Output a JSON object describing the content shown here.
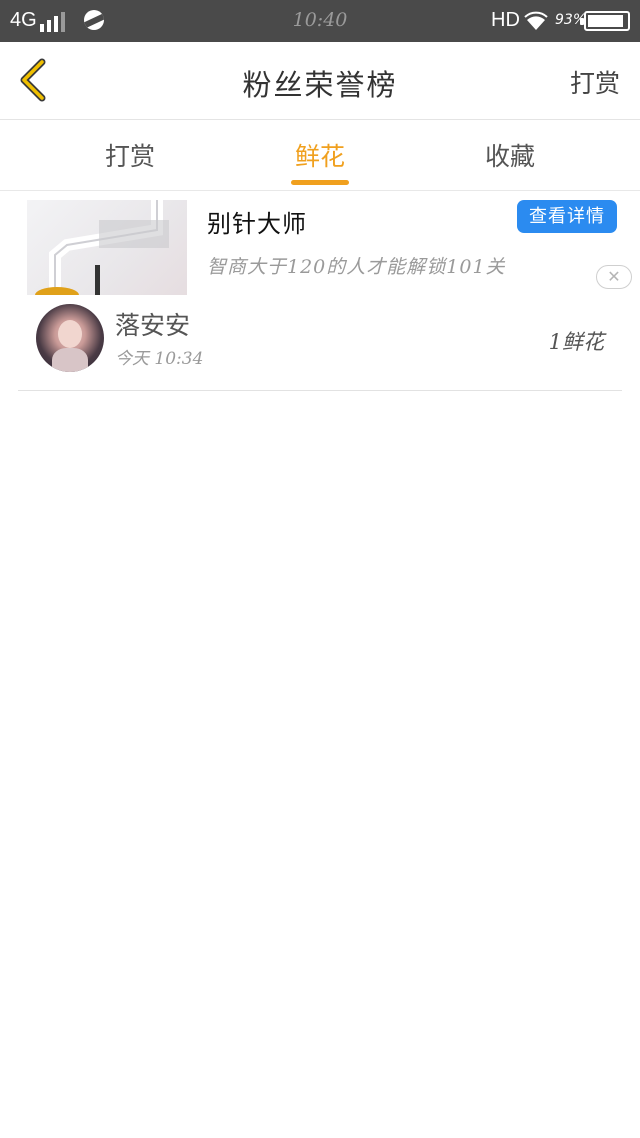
{
  "status_bar": {
    "network": "4G",
    "time": "10:40",
    "hd": "HD",
    "battery_percent": "93%",
    "battery_level": 0.93,
    "icons": [
      "signal-icon",
      "app-dot-icon",
      "wifi-icon",
      "battery-icon"
    ]
  },
  "header": {
    "title": "粉丝荣誉榜",
    "right_action": "打赏",
    "back_icon": "chevron-left-icon"
  },
  "tabs": [
    {
      "label": "打赏",
      "active": false
    },
    {
      "label": "鲜花",
      "active": true
    },
    {
      "label": "收藏",
      "active": false
    }
  ],
  "ad": {
    "title": "别针大师",
    "description": "智商大于120的人才能解锁101关",
    "button_label": "查看详情",
    "close_icon": "close-icon"
  },
  "list": [
    {
      "name": "落安安",
      "time": "今天 10:34",
      "gift": "1鲜花"
    }
  ],
  "colors": {
    "accent": "#f0a01e",
    "button_blue": "#2b8bf0",
    "status_bar": "#4a4a4a",
    "back_icon": "#f0c000"
  }
}
